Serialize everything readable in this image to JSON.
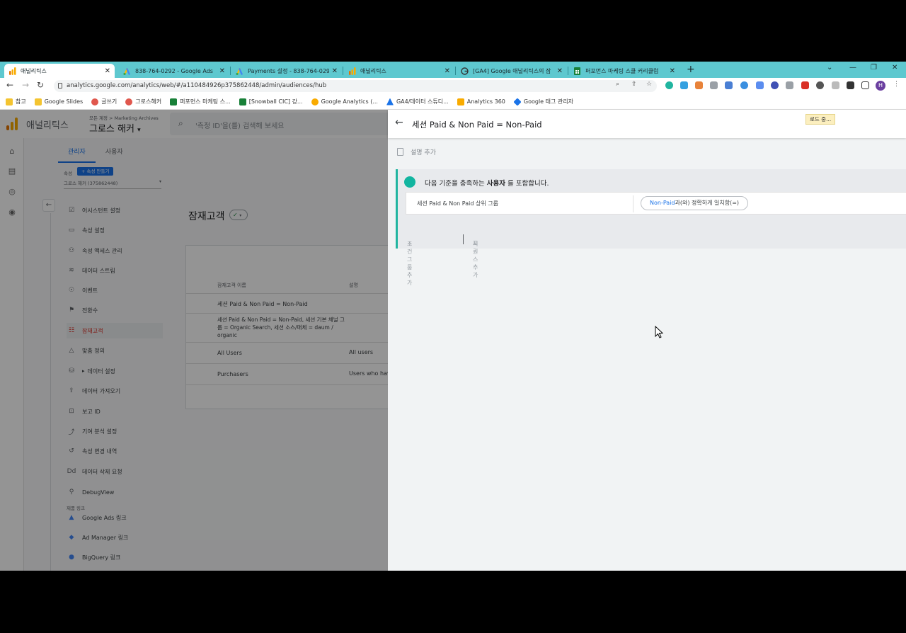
{
  "browser": {
    "tabs": [
      {
        "title": "애널리틱스",
        "active": true,
        "favicon": "ga-icon"
      },
      {
        "title": "838-764-0292 - Google Ads",
        "active": false,
        "favicon": "google-ads-icon"
      },
      {
        "title": "Payments 설정 - 838-764-0292",
        "active": false,
        "favicon": "google-ads-icon"
      },
      {
        "title": "애널리틱스",
        "active": false,
        "favicon": "ga-icon"
      },
      {
        "title": "[GA4] Google 애널리틱스의 잠",
        "active": false,
        "favicon": "google-icon"
      },
      {
        "title": "퍼포먼스 마케팅 스쿨 커리큘럼",
        "active": false,
        "favicon": "sheets-icon"
      }
    ],
    "url": "analytics.google.com/analytics/web/#/a110484926p375862448/admin/audiences/hub",
    "profile_initial": "H",
    "bookmarks": [
      {
        "label": "참고",
        "icon": "folder-icon",
        "color": "#f4c430"
      },
      {
        "label": "Google Slides",
        "icon": "folder-icon",
        "color": "#f4c430"
      },
      {
        "label": "글쓰기",
        "icon": "circle-red-icon",
        "color": "#e0574d"
      },
      {
        "label": "그로스해커",
        "icon": "circle-red-icon",
        "color": "#e0574d"
      },
      {
        "label": "퍼포먼스 마케팅 스...",
        "icon": "sheets-icon",
        "color": "#188038"
      },
      {
        "label": "[Snowball CIC] 강...",
        "icon": "sheets-icon",
        "color": "#188038"
      },
      {
        "label": "Google Analytics (...",
        "icon": "ga-bookmark-icon",
        "color": "#f9ab00"
      },
      {
        "label": "GA4/데이터 스튜디...",
        "icon": "drive-icon",
        "color": "#1a73e8"
      },
      {
        "label": "Analytics 360",
        "icon": "ga-icon",
        "color": "#f9ab00"
      },
      {
        "label": "Google 태그 관리자",
        "icon": "gtm-icon",
        "color": "#1a73e8"
      }
    ]
  },
  "ga": {
    "app_name": "애널리틱스",
    "account_path": "모든 계정 > Marketing Archives",
    "account_name": "그로스 해커",
    "search_placeholder": "'측정 ID'을(를) 검색해 보세요",
    "admin_tabs": [
      "관리자",
      "사용자"
    ],
    "property_label": "속성",
    "create_property": "속성 만들기",
    "property_select": "그로스 해커 (375862448)",
    "nav": [
      {
        "label": "어시스턴트 설정",
        "icon": "checkbox-icon"
      },
      {
        "label": "속성 설정",
        "icon": "settings-page-icon"
      },
      {
        "label": "속성 액세스 관리",
        "icon": "people-icon"
      },
      {
        "label": "데이터 스트림",
        "icon": "stream-icon"
      },
      {
        "label": "이벤트",
        "icon": "event-icon"
      },
      {
        "label": "전환수",
        "icon": "flag-icon"
      },
      {
        "label": "잠재고객",
        "icon": "audience-icon",
        "active": true
      },
      {
        "label": "맞춤 정의",
        "icon": "shapes-icon"
      },
      {
        "label": "데이터 설정",
        "icon": "database-icon"
      },
      {
        "label": "데이터 가져오기",
        "icon": "upload-icon"
      },
      {
        "label": "보고 ID",
        "icon": "reporting-id-icon"
      },
      {
        "label": "기여 분석 설정",
        "icon": "attribution-icon"
      },
      {
        "label": "속성 변경 내역",
        "icon": "history-icon"
      },
      {
        "label": "데이터 삭제 요청",
        "icon": "delete-data-icon"
      },
      {
        "label": "DebugView",
        "icon": "debug-icon"
      }
    ],
    "product_links_label": "제품 링크",
    "links": [
      {
        "label": "Google Ads 링크",
        "icon": "google-ads-icon"
      },
      {
        "label": "Ad Manager 링크",
        "icon": "ad-manager-icon"
      },
      {
        "label": "BigQuery 링크",
        "icon": "bigquery-icon"
      }
    ],
    "audiences": {
      "title": "잠재고객",
      "columns": [
        "잠재고객 이름",
        "설명"
      ],
      "rows": [
        {
          "name": "세션 Paid & Non Paid = Non-Paid",
          "desc": ""
        },
        {
          "name": "세션 Paid & Non Paid = Non-Paid, 세션 기본 채널 그룹 = Organic Search, 세션 소스/매체 = daum / organic",
          "desc": ""
        },
        {
          "name": "All Users",
          "desc": "All users"
        },
        {
          "name": "Purchasers",
          "desc": "Users who hav"
        }
      ]
    }
  },
  "panel": {
    "title": "세션 Paid & Non Paid = Non-Paid",
    "loading": "로드 중...",
    "add_description": "설명 추가",
    "condition_prefix": "다음 기준을 충족하는",
    "condition_bold": "사용자",
    "condition_suffix": "를 포함합니다.",
    "dimension": "세션 Paid & Non Paid 상위 그룹",
    "value": "Non-Paid",
    "match_suffix": "과(와) 정확하게 일치함(=)",
    "add_condition_group": "조건 그룹 추가",
    "add_sequence": "시퀀스 추가"
  },
  "colors": {
    "teal_tab": "#5ec8cf",
    "accent_teal": "#12b5a0",
    "ga_orange": "#f9ab00",
    "link_blue": "#1a73e8"
  }
}
